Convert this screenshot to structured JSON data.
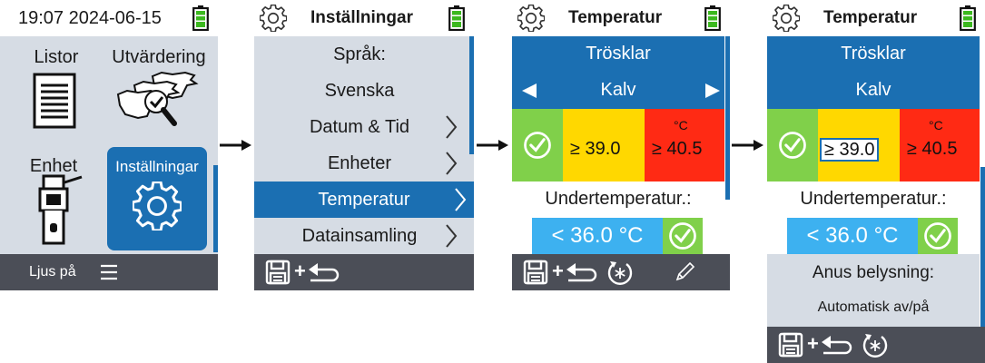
{
  "screen1": {
    "clock": "19:07 2024-06-15",
    "tiles": {
      "listor": "Listor",
      "utvardering": "Utvärdering",
      "enhet": "Enhet",
      "installningar": "Inställningar"
    },
    "footer": {
      "light_label": "Ljus på",
      "menu_icon": "hamburger-icon"
    }
  },
  "screen2": {
    "title": "Inställningar",
    "items": [
      {
        "label": "Språk:"
      },
      {
        "label": "Svenska"
      },
      {
        "label": "Datum & Tid"
      },
      {
        "label": "Enheter"
      },
      {
        "label": "Temperatur"
      },
      {
        "label": "Datainsamling"
      }
    ],
    "footer": {
      "icons": [
        "save-icon",
        "plus",
        "back-arrow-icon"
      ]
    }
  },
  "screen3": {
    "title": "Temperatur",
    "header1": "Trösklar",
    "header2": "Kalv",
    "threshold_mid": "≥ 39.0",
    "threshold_high": "≥ 40.5",
    "unit": "°C",
    "under_label": "Undertemperatur.:",
    "under_value": "< 36.0 °C",
    "footer": {
      "icons": [
        "save-icon",
        "back-arrow-icon",
        "reset-icon",
        "pencil-icon"
      ]
    }
  },
  "screen4": {
    "title": "Temperatur",
    "header1": "Trösklar",
    "header2": "Kalv",
    "threshold_mid": "≥ 39.0",
    "threshold_high": "≥ 40.5",
    "unit": "°C",
    "under_label": "Undertemperatur.:",
    "under_value": "< 36.0 °C",
    "anus_label": "Anus belysning:",
    "anus_value": "Automatisk av/på",
    "footer": {
      "icons": [
        "save-icon",
        "back-arrow-icon",
        "reset-icon"
      ]
    }
  },
  "colors": {
    "primary_blue": "#1b6fb2",
    "light_blue": "#3db1f0",
    "green": "#80d04a",
    "yellow": "#ffd800",
    "red": "#ff2a14",
    "panel_gray": "#d6dce4",
    "footer_gray": "#4b4e57"
  }
}
